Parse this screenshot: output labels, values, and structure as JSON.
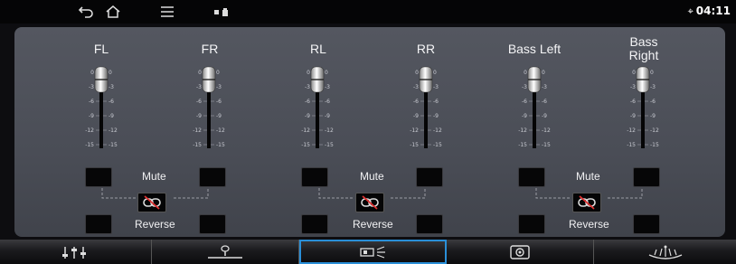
{
  "status": {
    "clock": "04:11"
  },
  "channels": [
    {
      "id": "fl",
      "label": "FL"
    },
    {
      "id": "fr",
      "label": "FR"
    },
    {
      "id": "rl",
      "label": "RL"
    },
    {
      "id": "rr",
      "label": "RR"
    },
    {
      "id": "bass-left",
      "label": "Bass Left"
    },
    {
      "id": "bass-right",
      "label": "Bass\nRight"
    }
  ],
  "scale": {
    "ticks": [
      "0",
      "-3",
      "-6",
      "-9",
      "-12",
      "-15"
    ]
  },
  "groups": [
    {
      "mute_label": "Mute",
      "reverse_label": "Reverse"
    },
    {
      "mute_label": "Mute",
      "reverse_label": "Reverse"
    },
    {
      "mute_label": "Mute",
      "reverse_label": "Reverse"
    }
  ],
  "bottom_tabs": [
    {
      "name": "equalizer-tab"
    },
    {
      "name": "balance-tab"
    },
    {
      "name": "speaker-level-tab",
      "active": true
    },
    {
      "name": "sound-mode-tab"
    },
    {
      "name": "sound-effect-tab"
    }
  ]
}
